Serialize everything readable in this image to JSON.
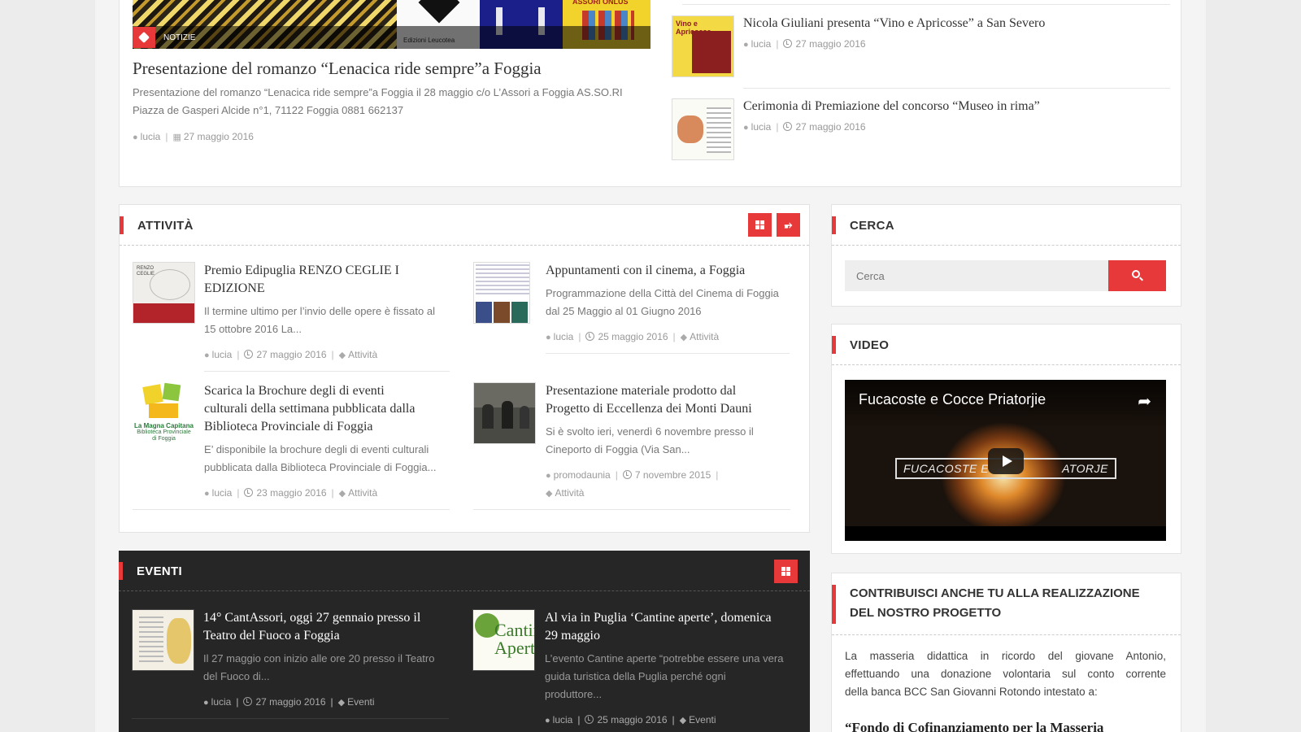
{
  "top": {
    "badge": "NOTIZIE",
    "featured_title": "Presentazione del romanzo “Lenacica ride sempre”a Foggia",
    "featured_excerpt_line1": "Presentazione del romanzo “Lenacica ride sempre”a Foggia il 28 maggio c/o L’Assori a Foggia AS.SO.RI",
    "featured_excerpt_line2": "Piazza de Gasperi Alcide n°1, 71122 Foggia 0881 662137",
    "featured_author": "lucia",
    "featured_date": "27 maggio 2016",
    "side_items": [
      {
        "title": "Nicola Giuliani presenta “Vino e Apricosse” a San Severo",
        "author": "lucia",
        "date": "27 maggio 2016"
      },
      {
        "title": "Cerimonia di Premiazione del concorso “Museo in rima”",
        "author": "lucia",
        "date": "27 maggio 2016"
      }
    ]
  },
  "attivita": {
    "label": "ATTIVITÀ",
    "items": [
      {
        "title_line1": "Premio Edipuglia RENZO CEGLIE I",
        "title_line2": "EDIZIONE",
        "excerpt_line1": "Il termine ultimo per l’invio delle opere è fissato al",
        "excerpt_line2": "15 ottobre 2016 La...",
        "author": "lucia",
        "date": "27 maggio 2016",
        "category": "Attività"
      },
      {
        "title_line1": "Appuntamenti con il cinema, a Foggia",
        "excerpt_line1": "Programmazione della Città del Cinema di Foggia",
        "excerpt_line2": "dal 25 Maggio al 01 Giugno 2016",
        "author": "lucia",
        "date": "25 maggio 2016",
        "category": "Attività"
      },
      {
        "title_line1": "Scarica la Brochure degli di eventi",
        "title_line2": "culturali della settimana pubblicata dalla",
        "title_line3": "Biblioteca Provinciale di Foggia",
        "excerpt_line1": "E’ disponibile la brochure degli di eventi culturali",
        "excerpt_line2": "pubblicata dalla Biblioteca Provinciale di Foggia...",
        "author": "lucia",
        "date": "23 maggio 2016",
        "category": "Attività",
        "thumb_caption1": "La Magna Capitana",
        "thumb_caption2": "Biblioteca Provinciale",
        "thumb_caption3": "di Foggia"
      },
      {
        "title_line1": "Presentazione materiale prodotto dal",
        "title_line2": "Progetto di Eccellenza dei Monti Dauni",
        "excerpt_line1": "Si è svolto ieri, venerdì 6 novembre presso il",
        "excerpt_line2": "Cineporto di Foggia (Via San...",
        "author": "promodaunia",
        "date": "7 novembre 2015",
        "category": "Attività"
      }
    ]
  },
  "eventi": {
    "label": "EVENTI",
    "items": [
      {
        "title_line1": "14° CantAssori, oggi 27 gennaio presso il",
        "title_line2": "Teatro del Fuoco a Foggia",
        "excerpt_line1": "Il 27 maggio con inizio alle ore 20 presso il Teatro",
        "excerpt_line2": "del Fuoco di...",
        "author": "lucia",
        "date": "27 maggio 2016",
        "category": "Eventi"
      },
      {
        "title_line1": "Al via in Puglia ‘Cantine aperte’, domenica",
        "title_line2": "29 maggio",
        "excerpt_line1": "L’evento Cantine aperte “potrebbe essere una vera",
        "excerpt_line2": "guida turistica della Puglia perché ogni",
        "excerpt_line3": "produttore...",
        "author": "lucia",
        "date": "25 maggio 2016",
        "category": "Eventi"
      }
    ]
  },
  "cerca": {
    "label": "CERCA",
    "placeholder": "Cerca"
  },
  "video": {
    "label": "VIDEO",
    "title": "Fucacoste e Cocce Priatorjie",
    "overlay_left": "FUCACOSTE E",
    "overlay_right": "ATORJE"
  },
  "contribuisci": {
    "label_line1": "CONTRIBUISCI ANCHE TU ALLA REALIZZAZIONE",
    "label_line2": "DEL NOSTRO PROGETTO",
    "text_line1": "La masseria didattica in ricordo del giovane Antonio,",
    "text_line2": "effettuando una donazione volontaria sul conto corrente",
    "text_line3": "della banca BCC San Giovanni Rotondo intestato a:",
    "quote": "“Fondo di Cofinanziamento per la Masseria"
  },
  "colors": {
    "accent": "#e8393a",
    "dark_section": "#262626"
  }
}
